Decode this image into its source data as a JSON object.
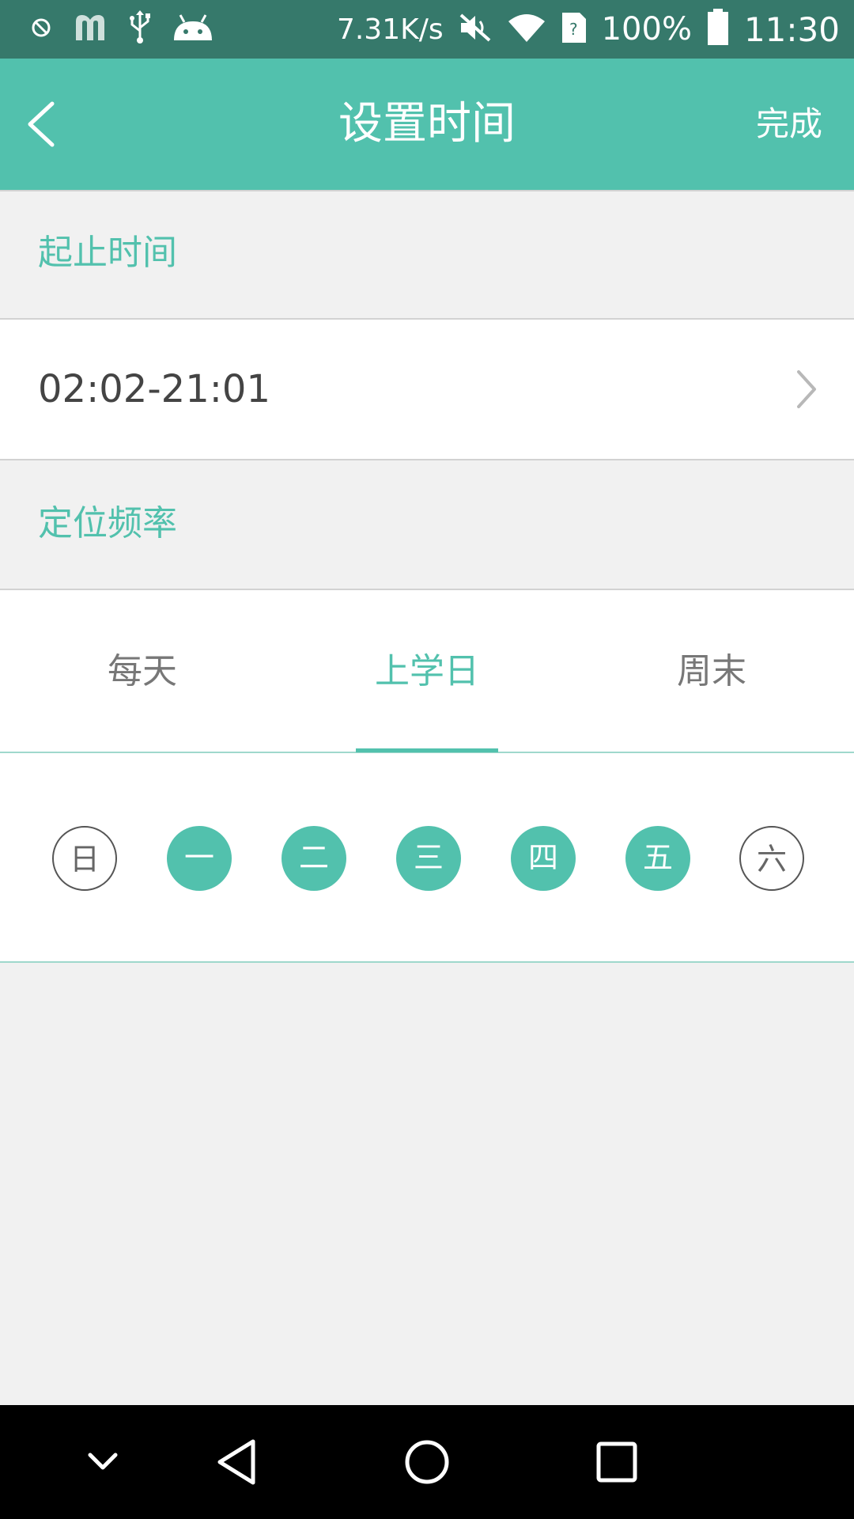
{
  "status_bar": {
    "net_speed": "7.31K/s",
    "battery_percent": "100%",
    "time": "11:30",
    "icons": [
      "blocked-icon",
      "m-app-icon",
      "usb-icon",
      "android-icon",
      "mute-icon",
      "wifi-icon",
      "sim-unknown-icon",
      "battery-icon"
    ]
  },
  "app_bar": {
    "title": "设置时间",
    "done_label": "完成",
    "back_icon": "chevron-left-icon"
  },
  "sections": {
    "time_range_header": "起止时间",
    "time_range_value": "02:02-21:01",
    "frequency_header": "定位频率"
  },
  "tabs": [
    {
      "label": "每天",
      "active": false
    },
    {
      "label": "上学日",
      "active": true
    },
    {
      "label": "周末",
      "active": false
    }
  ],
  "days": [
    {
      "label": "日",
      "selected": false
    },
    {
      "label": "一",
      "selected": true
    },
    {
      "label": "二",
      "selected": true
    },
    {
      "label": "三",
      "selected": true
    },
    {
      "label": "四",
      "selected": true
    },
    {
      "label": "五",
      "selected": true
    },
    {
      "label": "六",
      "selected": false
    }
  ],
  "colors": {
    "accent": "#52c1ad",
    "status_bar": "#36796b",
    "background": "#f1f1f1"
  },
  "nav_bar": {
    "icons": [
      "collapse-chevron-icon",
      "back-triangle-icon",
      "home-circle-icon",
      "recents-square-icon"
    ]
  }
}
